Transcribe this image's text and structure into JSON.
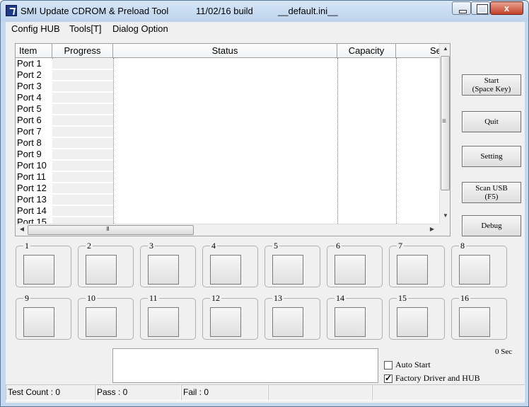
{
  "window": {
    "app_name": "SMI Update CDROM & Preload Tool",
    "build": "11/02/16 build",
    "ini": "__default.ini__",
    "close_symbol": "x"
  },
  "menu": {
    "config_hub": "Config HUB",
    "tools": "Tools[T]",
    "dialog_option": "Dialog Option"
  },
  "list": {
    "columns": [
      "Item",
      "Progress",
      "Status",
      "Capacity",
      "Se"
    ],
    "rows": [
      "Port 1",
      "Port 2",
      "Port 3",
      "Port 4",
      "Port 5",
      "Port 6",
      "Port 7",
      "Port 8",
      "Port 9",
      "Port 10",
      "Port 11",
      "Port 12",
      "Port 13",
      "Port 14",
      "Port 15"
    ]
  },
  "buttons": {
    "start": "Start\n(Space Key)",
    "quit": "Quit",
    "setting": "Setting",
    "scan": "Scan USB\n(F5)",
    "debug": "Debug"
  },
  "ports": [
    "1",
    "2",
    "3",
    "4",
    "5",
    "6",
    "7",
    "8",
    "9",
    "10",
    "11",
    "12",
    "13",
    "14",
    "15",
    "16"
  ],
  "timer": "0 Sec",
  "options": {
    "auto_start": {
      "label": "Auto Start",
      "checked": false
    },
    "factory_driver": {
      "label": "Factory Driver and HUB",
      "checked": true
    }
  },
  "status": {
    "test_count": "Test Count : 0",
    "pass": "Pass : 0",
    "fail": "Fail : 0",
    "pane4": "",
    "pane5": ""
  }
}
